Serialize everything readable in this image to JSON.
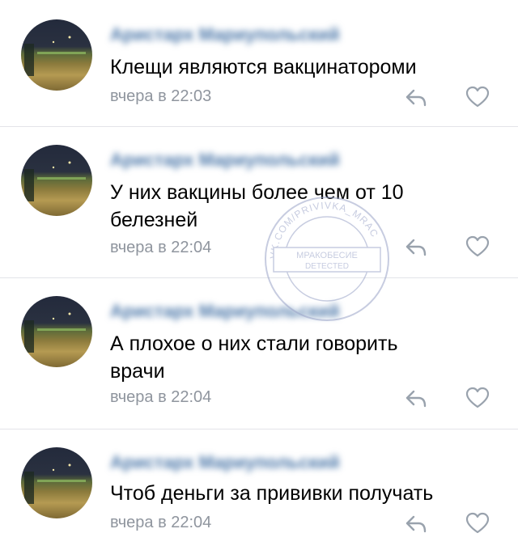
{
  "comments": [
    {
      "author": "Аристарх Мариупольский",
      "text": "Клещи являются вакцинатороми",
      "time": "вчера в 22:03"
    },
    {
      "author": "Аристарх Мариупольский",
      "text": "У них вакцины более чем от 10 белезней",
      "time": "вчера в 22:04"
    },
    {
      "author": "Аристарх Мариупольский",
      "text": "А плохое о них стали говорить врачи",
      "time": "вчера в 22:04"
    },
    {
      "author": "Аристарх Мариупольский",
      "text": "Чтоб деньги за прививки получать",
      "time": "вчера в 22:04"
    }
  ],
  "actions": {
    "reply_icon": "reply-arrow-icon",
    "like_icon": "heart-outline-icon"
  },
  "watermark": {
    "ring_text": "VK.COM/PRIVIVKA_MRAC",
    "line1": "МРАКОБЕСИЕ",
    "line2": "DETECTED"
  },
  "colors": {
    "author": "#4a76a8",
    "time": "#8f959e",
    "icon": "#99a2ad",
    "divider": "#e3e4e8"
  }
}
